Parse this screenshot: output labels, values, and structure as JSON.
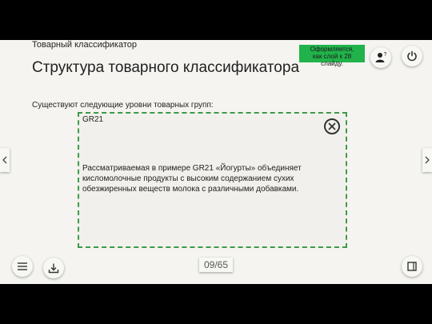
{
  "header": {
    "breadcrumb": "Товарный классификатор",
    "title": "Структура товарного классификатора"
  },
  "note_badge": {
    "lines": [
      "Оформляется,",
      "как слой к 28",
      "слайду."
    ],
    "color": "#21b24b"
  },
  "toolbar": {
    "help_icon": "user-question-icon",
    "power_icon": "power-icon",
    "menu_icon": "hamburger-menu-icon",
    "download_icon": "download-icon",
    "expand_icon": "expand-window-icon"
  },
  "content": {
    "lead": "Существуют следующие уровни товарных групп:"
  },
  "popup": {
    "title": "GR21",
    "body": "Рассматриваемая в примере GR21 «Йогурты» объединяет кисломолочные продукты с высоким содержанием сухих обезжиренных веществ молока с различными добавками.",
    "border_color": "#3f9a4a"
  },
  "navigation": {
    "prev_icon": "chevron-left-icon",
    "next_icon": "chevron-right-icon",
    "counter": "09/65"
  }
}
